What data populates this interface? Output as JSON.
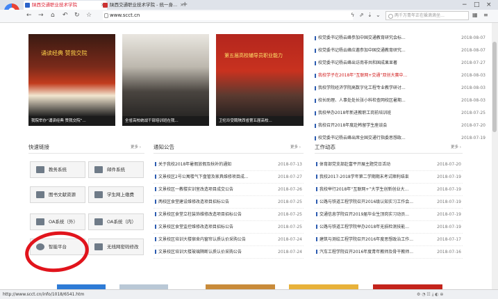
{
  "browser": {
    "tabs": [
      {
        "label": "陕西交通职业技术学院"
      },
      {
        "label": "陕西交通职业技术学院 - 统一身..."
      }
    ],
    "url": "www.scct.cn",
    "search_placeholder": "两千万青年正在躲滴滴坐…",
    "status_url": "http://www.scct.cn/info/1018/6541.htm"
  },
  "photos": [
    {
      "caption": "我院举办“诵读经典 赞我交院”..."
    },
    {
      "caption": "全省高校统战干部培训班在我..."
    },
    {
      "caption": "卫伦玲受聘陕西省第五届高校..."
    }
  ],
  "photo_texts": {
    "p1_sign": "诵读经典 赞我交院",
    "p3_sign": "第五届高校辅导员职业能力"
  },
  "news_top": [
    {
      "title": "校党委书记杨云峰参加中国交通教育研究会标...",
      "date": "2018-08-07",
      "highlight": false
    },
    {
      "title": "校党委书记杨云峰应邀参加中国交通教育研究...",
      "date": "2018-08-07",
      "highlight": false
    },
    {
      "title": "校党委书记杨云峰出访南非共和国成果显著",
      "date": "2018-07-27",
      "highlight": false
    },
    {
      "title": "我校学子在2018年“互联网+交通”双创大赛中...",
      "date": "2018-08-03",
      "highlight": true
    },
    {
      "title": "我校学院经济学院高数字化工程专业教学研讨...",
      "date": "2018-08-03",
      "highlight": false
    },
    {
      "title": "校长助理、人事处处长张小科检查网校区暑期...",
      "date": "2018-08-03",
      "highlight": false
    },
    {
      "title": "我校举办2018年新进教职工岗前培训班",
      "date": "2018-07-25",
      "highlight": false
    },
    {
      "title": "我校召开2018年度赴韩留学生座谈会",
      "date": "2018-07-20",
      "highlight": false
    },
    {
      "title": "校党委书记杨云峰出席全国交通行指委思想政...",
      "date": "2018-07-19",
      "highlight": false
    }
  ],
  "quick_links": {
    "title": "快速链接",
    "more": "更多 ›",
    "buttons": [
      {
        "label": "教务系统",
        "icon": "gear-icon"
      },
      {
        "label": "邮件系统",
        "icon": "mail-icon"
      },
      {
        "label": "图书文献资源",
        "icon": "book-icon"
      },
      {
        "label": "学生网上缴费",
        "icon": "monitor-icon"
      },
      {
        "label": "OA系统（外）",
        "icon": "oa-icon"
      },
      {
        "label": "OA系统（内）",
        "icon": "oa-icon"
      },
      {
        "label": "智能平台",
        "icon": "smart-icon"
      },
      {
        "label": "无线网密码修改",
        "icon": "wifi-icon"
      }
    ]
  },
  "notices": {
    "title": "通知公告",
    "more": "更多 ›",
    "items": [
      {
        "title": "关于我校2018年暑假放假及秋补的通知",
        "date": "2018-07-13"
      },
      {
        "title": "文景校区2号公寓楼气下盘管及家具维修项目成...",
        "date": "2018-07-27"
      },
      {
        "title": "文景校区一教楼实训室改造项目成交公告",
        "date": "2018-07-26"
      },
      {
        "title": "两校区食堂建设维修改造项目招标公告",
        "date": "2018-07-25"
      },
      {
        "title": "文景校区食堂立柱装饰维修改造项目招标公告",
        "date": "2018-07-25"
      },
      {
        "title": "文景校区食堂监控维修改造项目招标公告",
        "date": "2018-07-25"
      },
      {
        "title": "文景校区培训大楼宿舍内窗帘认质认价采购公告",
        "date": "2018-07-24"
      },
      {
        "title": "文景校区培训大楼玻璃隔断认质认价采购公告",
        "date": "2018-07-24"
      }
    ]
  },
  "work": {
    "title": "工作动态",
    "more": "更多 ›",
    "items": [
      {
        "title": "体育部党支部赴富平开展主题党日活动",
        "date": "2018-07-20"
      },
      {
        "title": "我校2017-2018学年第二学期期末考试顺利结束",
        "date": "2018-07-19"
      },
      {
        "title": "我校举行2018年“互联网+”大学生创新创业大...",
        "date": "2018-07-19"
      },
      {
        "title": "公路与铁道工程学院召开2016级认知实习工作会...",
        "date": "2018-07-19"
      },
      {
        "title": "交通信息学院召开2019届毕业生顶岗实习动员...",
        "date": "2018-07-19"
      },
      {
        "title": "公路与铁道工程学院举办2018年无损检测技能...",
        "date": "2018-07-19"
      },
      {
        "title": "建筑与测绘工程学院召开2016年度思想政治工作...",
        "date": "2018-07-17"
      },
      {
        "title": "汽车工程学院召开2016年度青年教师及骨干教师...",
        "date": "2018-07-16"
      }
    ]
  },
  "colors": {
    "accent_blue": "#2b5bb0",
    "highlight_red": "#d01a1a",
    "annotation_red": "#e1141c"
  }
}
